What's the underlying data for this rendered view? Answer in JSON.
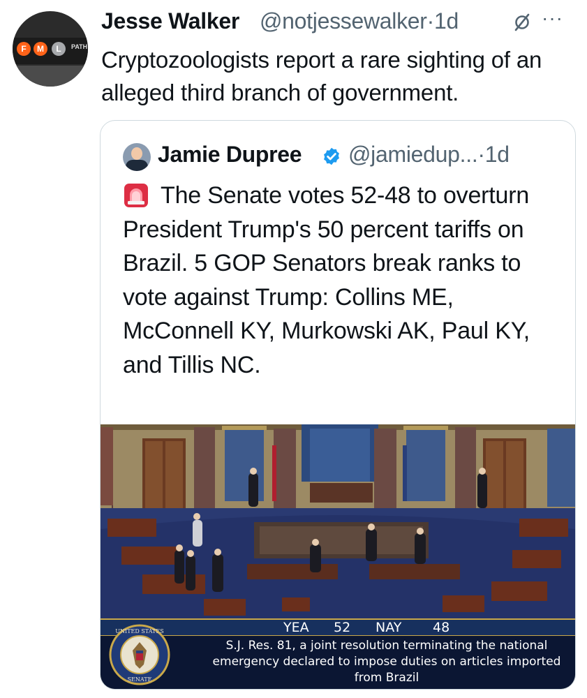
{
  "tweet": {
    "author_name": "Jesse Walker",
    "author_handle": "@notjessewalker",
    "separator": "·",
    "time": "1d",
    "more_label": "···",
    "text": "Cryptozoologists report a rare sighting of an alleged third branch of government.",
    "avatar_sign": {
      "letters": [
        "F",
        "M",
        "L"
      ],
      "path_label": "PATH"
    },
    "quoted": {
      "author_name": "Jamie Dupree",
      "author_handle": "@jamiedup...",
      "separator": "·",
      "time": "1d",
      "text": "The Senate votes 52-48 to overturn President Trump's 50 percent tariffs on Brazil.  5 GOP Senators break ranks to vote against Trump:  Collins ME, McConnell KY, Murkowski AK, Paul KY, and Tillis NC.",
      "media": {
        "vote_yea_label": "YEA",
        "vote_yea_count": "52",
        "vote_nay_label": "NAY",
        "vote_nay_count": "48",
        "caption": "S.J. Res. 81, a joint resolution terminating the national emergency declared to impose duties on articles imported from Brazil",
        "seal_text": "UNITED STATES SENATE"
      }
    }
  },
  "icons": {
    "verified": "verified-badge-icon",
    "siren": "rotating-light-emoji",
    "grok": "grok-icon",
    "more": "more-icon"
  },
  "colors": {
    "text_primary": "#0f1419",
    "text_secondary": "#536471",
    "verified_blue": "#1d9bf0",
    "border": "#cfd9de",
    "chyron_navy": "#0b1633",
    "chyron_gold": "#c9a84a"
  }
}
